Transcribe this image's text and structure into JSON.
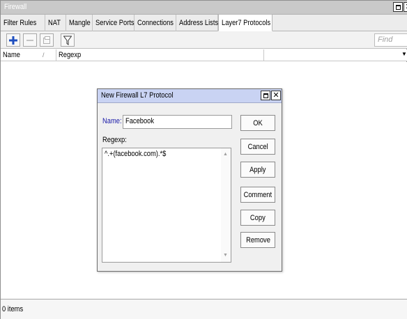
{
  "window": {
    "title": "Firewall"
  },
  "tabs": [
    "Filter Rules",
    "NAT",
    "Mangle",
    "Service Ports",
    "Connections",
    "Address Lists",
    "Layer7 Protocols"
  ],
  "active_tab": "Layer7 Protocols",
  "toolbar": {
    "buttons": [
      "plus-icon",
      "minus-icon",
      "copy-icon",
      "filter-icon"
    ],
    "find_placeholder": "Find"
  },
  "table": {
    "columns": [
      "Name",
      "Regexp"
    ],
    "sort_indicator": "/",
    "rows": []
  },
  "status": {
    "items_text": "0 items"
  },
  "dialog": {
    "title": "New Firewall L7 Protocol",
    "name_label": "Name:",
    "name_value": "Facebook",
    "regexp_label": "Regexp:",
    "regexp_value": "^.+(facebook.com).*$",
    "buttons": {
      "ok": "OK",
      "cancel": "Cancel",
      "apply": "Apply",
      "comment": "Comment",
      "copy": "Copy",
      "remove": "Remove"
    }
  },
  "colors": {
    "add_icon": "#1f4fbf",
    "dialog_titlebar": "#c9d3f3",
    "label_blue": "#1a1aa8"
  }
}
